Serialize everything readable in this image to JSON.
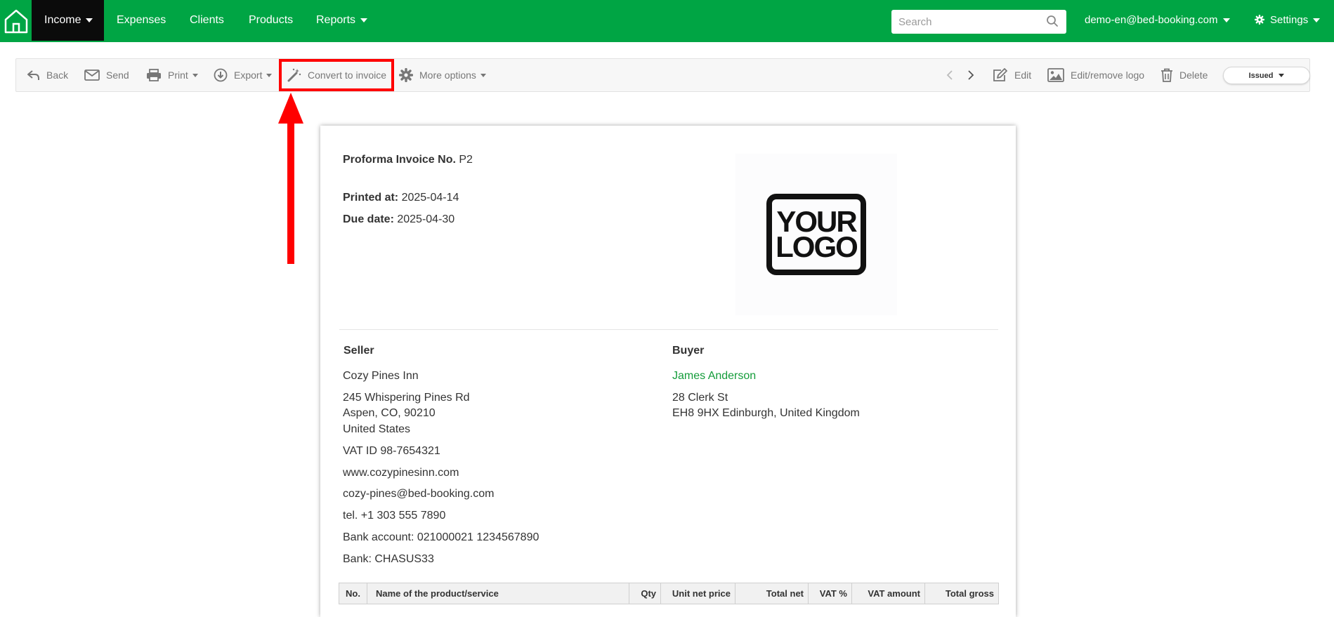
{
  "nav": {
    "items": [
      {
        "label": "Income",
        "dropdown": true,
        "active": true
      },
      {
        "label": "Expenses",
        "dropdown": false
      },
      {
        "label": "Clients",
        "dropdown": false
      },
      {
        "label": "Products",
        "dropdown": false
      },
      {
        "label": "Reports",
        "dropdown": true
      }
    ],
    "search_placeholder": "Search",
    "user": "demo-en@bed-booking.com",
    "settings": "Settings"
  },
  "toolbar": {
    "back": "Back",
    "send": "Send",
    "print": "Print",
    "export": "Export",
    "convert": "Convert to invoice",
    "more": "More options",
    "edit": "Edit",
    "edit_logo": "Edit/remove logo",
    "delete": "Delete",
    "status": "Issued"
  },
  "document": {
    "title_label": "Proforma Invoice No.",
    "number": "P2",
    "printed_label": "Printed at:",
    "printed_value": "2025-04-14",
    "due_label": "Due date:",
    "due_value": "2025-04-30",
    "logo_line1": "YOUR",
    "logo_line2": "LOGO",
    "seller": {
      "heading": "Seller",
      "name": "Cozy Pines Inn",
      "address1": "245 Whispering Pines Rd",
      "address2": "Aspen, CO, 90210",
      "country": "United States",
      "vat": "VAT ID 98-7654321",
      "website": "www.cozypinesinn.com",
      "email": "cozy-pines@bed-booking.com",
      "phone": "tel. +1 303 555 7890",
      "bank_account": "Bank account: 021000021 1234567890",
      "bank": "Bank: CHASUS33"
    },
    "buyer": {
      "heading": "Buyer",
      "name": "James Anderson",
      "address1": "28 Clerk St",
      "address2": "EH8 9HX Edinburgh, United Kingdom"
    },
    "table": {
      "columns": [
        "No.",
        "Name of the product/service",
        "Qty",
        "Unit net price",
        "Total net",
        "VAT %",
        "VAT amount",
        "Total gross"
      ]
    }
  },
  "colors": {
    "brand": "#00a544",
    "highlight": "#ff0000",
    "buyer_link": "#149c3a"
  }
}
